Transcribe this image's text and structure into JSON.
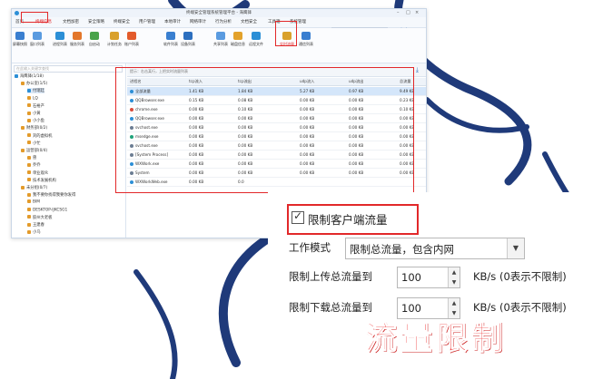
{
  "window": {
    "title": "终端安全管理系统管理平台 - 海鹰锋"
  },
  "menu": {
    "items": [
      "首页",
      "终端信息",
      "文档加密",
      "安全策略",
      "终端安全",
      "用户管理",
      "本地审计",
      "网络审计",
      "行为分析",
      "文档安全",
      "工具箱",
      "系统管理"
    ],
    "active_index": 1,
    "search_placeholder": "快速查找功能",
    "user": "admin"
  },
  "toolbar": {
    "buttons": [
      "屏幕快照",
      "窗口列表",
      "进程列表",
      "服务列表",
      "自启动",
      "计划任务",
      "账户列表",
      "软件列表",
      "设备列表",
      "共享列表",
      "磁盘信息",
      "远程文件",
      "实时流量",
      "通信列表"
    ],
    "highlighted": "实时流量",
    "groups": [
      "任务管理器",
      "设备信息",
      "文件系统",
      "网络状态"
    ]
  },
  "left_panel": {
    "search_placeholder": "在此输入关键字查找",
    "tree": [
      {
        "label": "海鹰锋(1/18)",
        "level": 0,
        "color": "#2c8fd6"
      },
      {
        "label": "办公室(1/5)",
        "level": 1,
        "color": "#e39b2b"
      },
      {
        "label": "付瑞廷",
        "level": 2,
        "color": "#2c8fd6",
        "selected": true
      },
      {
        "label": "LQ",
        "level": 2,
        "color": "#e39b2b"
      },
      {
        "label": "石裕产",
        "level": 2,
        "color": "#e39b2b"
      },
      {
        "label": "小黄",
        "level": 2,
        "color": "#e39b2b"
      },
      {
        "label": "小小鱼",
        "level": 2,
        "color": "#e39b2b"
      },
      {
        "label": "财务部(0/2)",
        "level": 1,
        "color": "#e39b2b"
      },
      {
        "label": "刘的虚拟机",
        "level": 2,
        "color": "#e39b2b"
      },
      {
        "label": "小忙",
        "level": 2,
        "color": "#e39b2b"
      },
      {
        "label": "运营部(0/4)",
        "level": 1,
        "color": "#e39b2b"
      },
      {
        "label": "兽",
        "level": 2,
        "color": "#e39b2b"
      },
      {
        "label": "乔乔",
        "level": 2,
        "color": "#e39b2b"
      },
      {
        "label": "单业观众",
        "level": 2,
        "color": "#e39b2b"
      },
      {
        "label": "技术发展机构",
        "level": 2,
        "color": "#e39b2b"
      },
      {
        "label": "未分组(0/7)",
        "level": 1,
        "color": "#e39b2b"
      },
      {
        "label": "我不要你找得我要你发得",
        "level": 2,
        "color": "#e39b2b"
      },
      {
        "label": "BIM",
        "level": 2,
        "color": "#e39b2b"
      },
      {
        "label": "DESKTOP-IJKCSG1",
        "level": 2,
        "color": "#e39b2b"
      },
      {
        "label": "胶州大老板",
        "level": 2,
        "color": "#e39b2b"
      },
      {
        "label": "王建春",
        "level": 2,
        "color": "#e39b2b"
      },
      {
        "label": "小乌",
        "level": 2,
        "color": "#e39b2b"
      }
    ]
  },
  "traffic_table": {
    "tip": "提示：右击某行，上把实时流量列表",
    "columns": [
      "进程名",
      "tcp流入",
      "tcp流出",
      "udp流入",
      "udp流出",
      "总流量"
    ],
    "rows": [
      {
        "name": "全部流量",
        "tcp_in": "1.41 KB",
        "tcp_out": "1.84 KB",
        "udp_in": "5.27 KB",
        "udp_out": "0.97 KB",
        "total": "9.49 KB",
        "color": "#2c8fd6"
      },
      {
        "name": "QQBrowser.exe",
        "tcp_in": "0.15 KB",
        "tcp_out": "0.08 KB",
        "udp_in": "0.00 KB",
        "udp_out": "0.00 KB",
        "total": "0.23 KB",
        "color": "#2c8fd6"
      },
      {
        "name": "chrome.exe",
        "tcp_in": "0.00 KB",
        "tcp_out": "0.10 KB",
        "udp_in": "0.00 KB",
        "udp_out": "0.00 KB",
        "total": "0.10 KB",
        "color": "#d94b3a"
      },
      {
        "name": "QQBrowser.exe",
        "tcp_in": "0.00 KB",
        "tcp_out": "0.00 KB",
        "udp_in": "0.00 KB",
        "udp_out": "0.00 KB",
        "total": "0.00 KB",
        "color": "#2c8fd6"
      },
      {
        "name": "svchost.exe",
        "tcp_in": "0.00 KB",
        "tcp_out": "0.00 KB",
        "udp_in": "0.00 KB",
        "udp_out": "0.00 KB",
        "total": "0.00 KB",
        "color": "#6b7d93"
      },
      {
        "name": "msedge.exe",
        "tcp_in": "0.00 KB",
        "tcp_out": "0.00 KB",
        "udp_in": "0.00 KB",
        "udp_out": "0.00 KB",
        "total": "0.00 KB",
        "color": "#1fa37a"
      },
      {
        "name": "svchost.exe",
        "tcp_in": "0.00 KB",
        "tcp_out": "0.00 KB",
        "udp_in": "0.00 KB",
        "udp_out": "0.00 KB",
        "total": "0.00 KB",
        "color": "#6b7d93"
      },
      {
        "name": "[System Process]",
        "tcp_in": "0.00 KB",
        "tcp_out": "0.00 KB",
        "udp_in": "0.00 KB",
        "udp_out": "0.00 KB",
        "total": "0.00 KB",
        "color": "#6b7d93"
      },
      {
        "name": "WXWork.exe",
        "tcp_in": "0.00 KB",
        "tcp_out": "0.00 KB",
        "udp_in": "0.00 KB",
        "udp_out": "0.00 KB",
        "total": "0.00 KB",
        "color": "#2c8fd6"
      },
      {
        "name": "System",
        "tcp_in": "0.00 KB",
        "tcp_out": "0.00 KB",
        "udp_in": "0.00 KB",
        "udp_out": "0.00 KB",
        "total": "0.00 KB",
        "color": "#6b7d93"
      },
      {
        "name": "WXWorkWeb.exe",
        "tcp_in": "0.00 KB",
        "tcp_out": "0.0",
        "udp_in": "",
        "udp_out": "",
        "total": "",
        "color": "#2c8fd6"
      }
    ],
    "selected_index": 0
  },
  "settings": {
    "limit_checkbox_label": "限制客户端流量",
    "limit_checked": true,
    "work_mode_label": "工作模式",
    "work_mode_value": "限制总流量，包含内网",
    "upload_label": "限制上传总流量到",
    "upload_value": "100",
    "download_label": "限制下载总流量到",
    "download_value": "100",
    "unit_hint": "KB/s (0表示不限制)"
  },
  "banner_text": "流量限制",
  "colors": {
    "accent_red": "#e2282a",
    "brand_blue": "#2c8fd6",
    "banner_red": "#ef3b3b"
  }
}
